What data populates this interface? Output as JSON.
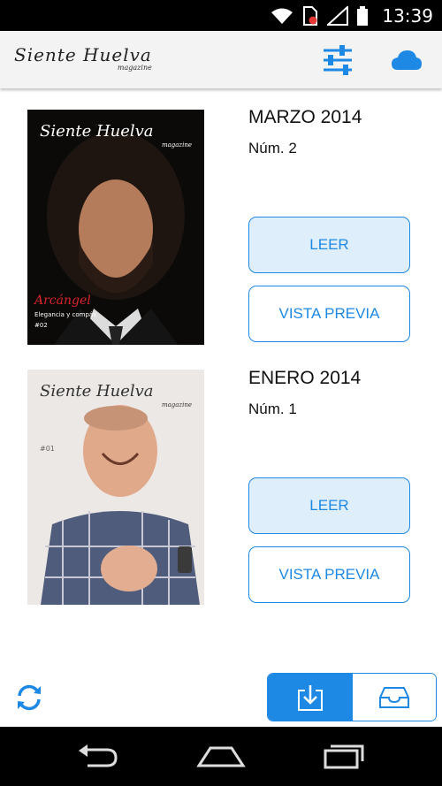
{
  "status_bar": {
    "time": "13:39",
    "icons": [
      "wifi-icon",
      "sim-no-service-icon",
      "signal-icon",
      "battery-icon"
    ]
  },
  "app_bar": {
    "logo_text": "Siente Huelva",
    "logo_subtitle": "magazine",
    "actions": [
      "filter-sliders-icon",
      "cloud-icon"
    ]
  },
  "issues": [
    {
      "title": "MARZO 2014",
      "number": "Núm. 2",
      "read_label": "LEER",
      "preview_label": "VISTA PREVIA",
      "cover": {
        "masthead": "Siente Huelva",
        "masthead_sub": "magazine",
        "name": "Arcángel",
        "tagline": "Elegancia y compás",
        "issue_tag": "#02"
      }
    },
    {
      "title": "ENERO 2014",
      "number": "Núm. 1",
      "read_label": "LEER",
      "preview_label": "VISTA PREVIA",
      "cover": {
        "masthead": "Siente Huelva",
        "masthead_sub": "magazine",
        "issue_tag": "#01"
      }
    }
  ],
  "bottom_bar": {
    "actions": [
      "refresh-icon",
      "download-icon",
      "inbox-icon"
    ]
  },
  "nav_bar": {
    "buttons": [
      "back-icon",
      "home-icon",
      "recents-icon"
    ]
  },
  "colors": {
    "accent": "#1e88e5",
    "button_fill": "#dfeefb",
    "appbar": "#f3f3f3"
  }
}
